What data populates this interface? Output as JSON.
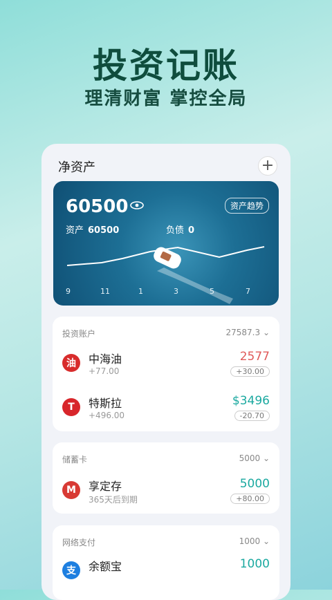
{
  "hero": {
    "title": "投资记账",
    "subtitle": "理清财富  掌控全局"
  },
  "panel": {
    "title": "净资产",
    "add_icon": "plus-icon"
  },
  "net": {
    "value": "60500",
    "trend_label": "资产趋势",
    "asset_label": "资产",
    "asset_value": "60500",
    "debt_label": "负债",
    "debt_value": "0",
    "x_ticks": [
      "9",
      "11",
      "1",
      "3",
      "5",
      "7"
    ]
  },
  "investment": {
    "header": "投资账户",
    "total": "27587.3",
    "items": [
      {
        "name": "中海油",
        "sub": "+77.00",
        "value": "2577",
        "badge": "+30.00",
        "color": "#e05a5a"
      },
      {
        "name": "特斯拉",
        "sub": "+496.00",
        "value": "$3496",
        "badge": "-20.70",
        "color": "#1ba9a0"
      }
    ]
  },
  "savings": {
    "header": "储蓄卡",
    "total": "5000",
    "items": [
      {
        "name": "享定存",
        "sub": "365天后到期",
        "value": "5000",
        "badge": "+80.00",
        "color": "#1ba9a0"
      }
    ]
  },
  "payment": {
    "header": "网络支付",
    "total": "1000",
    "items": [
      {
        "name": "余额宝",
        "value": "1000",
        "color": "#1ba9a0"
      }
    ]
  }
}
